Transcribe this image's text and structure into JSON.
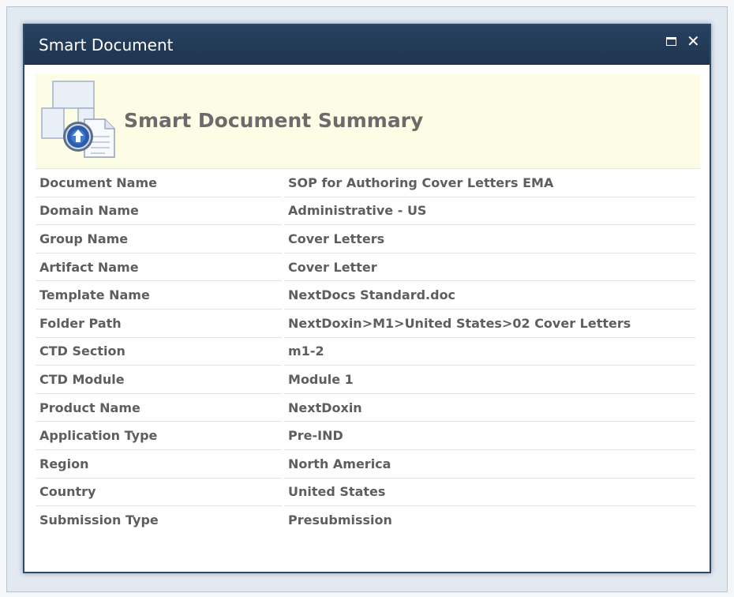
{
  "window": {
    "title": "Smart Document",
    "maximize_icon": "maximize-icon",
    "close_icon": "close-icon",
    "titlebar_color": "#22395a"
  },
  "summary": {
    "title": "Smart Document Summary",
    "icon": "smart-document-icon",
    "header_background": "#fdfde6",
    "rows": [
      {
        "label": "Document Name",
        "value": "SOP for Authoring Cover Letters EMA"
      },
      {
        "label": "Domain Name",
        "value": "Administrative - US"
      },
      {
        "label": "Group Name",
        "value": "Cover Letters"
      },
      {
        "label": "Artifact Name",
        "value": "Cover Letter"
      },
      {
        "label": "Template Name",
        "value": "NextDocs Standard.doc"
      },
      {
        "label": "Folder Path",
        "value": "NextDoxin>M1>United States>02 Cover Letters"
      },
      {
        "label": "CTD Section",
        "value": "m1-2"
      },
      {
        "label": "CTD Module",
        "value": "Module 1"
      },
      {
        "label": "Product Name",
        "value": "NextDoxin"
      },
      {
        "label": "Application Type",
        "value": "Pre-IND"
      },
      {
        "label": "Region",
        "value": "North America"
      },
      {
        "label": "Country",
        "value": "United States"
      },
      {
        "label": "Submission Type",
        "value": "Presubmission"
      }
    ]
  }
}
